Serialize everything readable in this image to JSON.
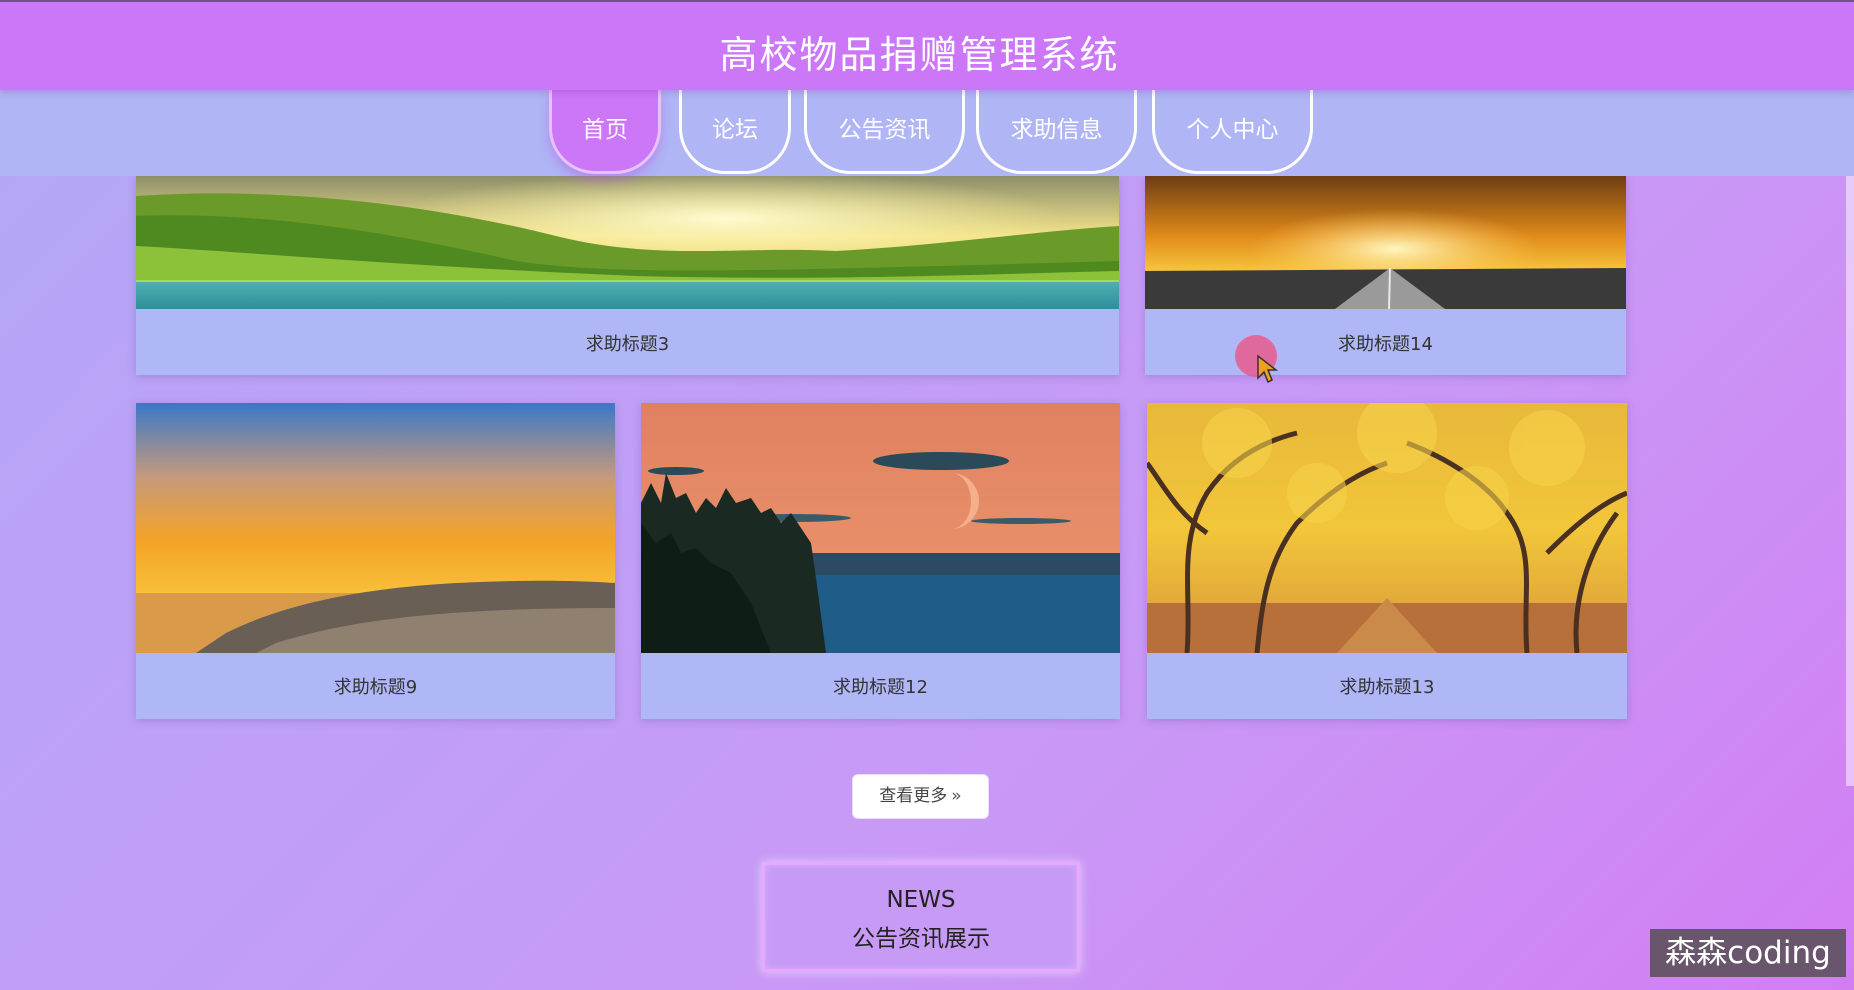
{
  "header": {
    "title": "高校物品捐赠管理系统"
  },
  "nav": {
    "items": [
      {
        "label": "首页",
        "active": true
      },
      {
        "label": "论坛",
        "active": false
      },
      {
        "label": "公告资讯",
        "active": false
      },
      {
        "label": "求助信息",
        "active": false
      },
      {
        "label": "个人中心",
        "active": false
      }
    ]
  },
  "cards": [
    {
      "title": "求助标题3",
      "image": "green-valley-sunrise-lake"
    },
    {
      "title": "求助标题14",
      "image": "sunset-road"
    },
    {
      "title": "求助标题9",
      "image": "orange-sunset-coast-rocks"
    },
    {
      "title": "求助标题12",
      "image": "moon-over-lake-pines"
    },
    {
      "title": "求助标题13",
      "image": "golden-autumn-tree-avenue"
    }
  ],
  "more_button": {
    "label": "查看更多",
    "icon": "double-chevron-right-icon"
  },
  "news_section": {
    "title_en": "NEWS",
    "title_zh": "公告资讯展示"
  },
  "watermark": "森森coding",
  "colors": {
    "header_bg": "#cc76f8",
    "nav_bg": "#afb5f5",
    "card_bg": "#afb7f6",
    "accent_border": "#e9a7ff"
  }
}
